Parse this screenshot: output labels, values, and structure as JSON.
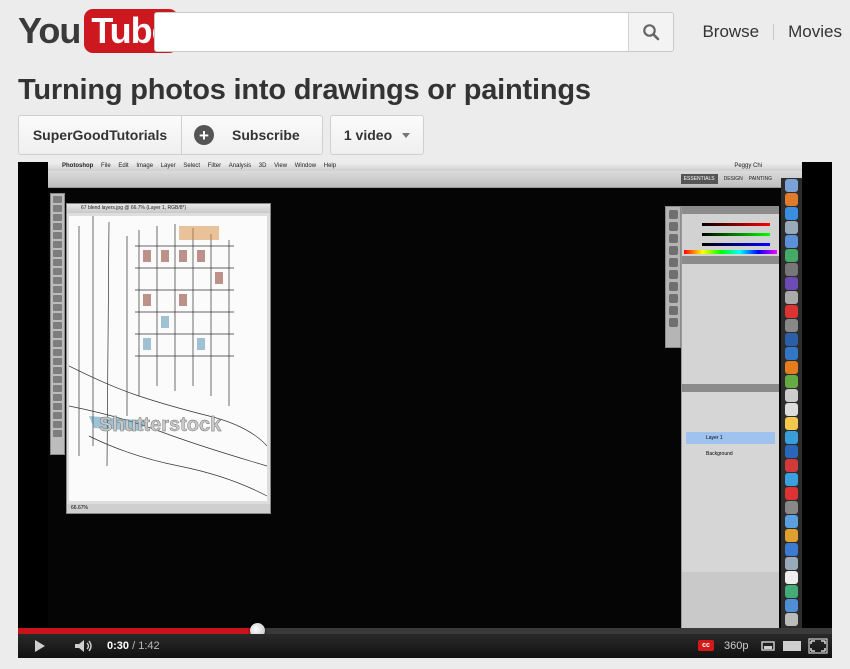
{
  "header": {
    "logo_you": "You",
    "logo_tube": "Tube",
    "search_placeholder": "",
    "search_value": "",
    "nav": [
      "Browse",
      "Movies"
    ]
  },
  "video": {
    "title": "Turning photos into drawings or paintings",
    "channel": "SuperGoodTutorials",
    "subscribe_label": "Subscribe",
    "videos_label": "1 video"
  },
  "player": {
    "current_time": "0:30",
    "duration": "1:42",
    "time_separator": " / ",
    "progress_fraction": 0.294,
    "quality": "360p",
    "cc_label": "cc",
    "accent": "#c8141a"
  },
  "screen": {
    "menubar": [
      "Photoshop",
      "File",
      "Edit",
      "Image",
      "Layer",
      "Select",
      "Filter",
      "Analysis",
      "3D",
      "View",
      "Window",
      "Help"
    ],
    "status_user": "Peggy Chi",
    "workspaces": [
      "ESSENTIALS",
      "DESIGN",
      "PAINTING"
    ],
    "document_tab": "67 blend layers.jpg @ 66.7% (Layer 1, RGB/8*)",
    "watermark": "Shutterstock",
    "zoom": "66.67%",
    "layers": [
      "Layer 1",
      "Background"
    ]
  },
  "icons": [
    "search-icon",
    "plus-icon",
    "chevron-down-icon",
    "play-icon",
    "volume-icon",
    "cc-icon",
    "theater-icon",
    "fullscreen-icon"
  ]
}
